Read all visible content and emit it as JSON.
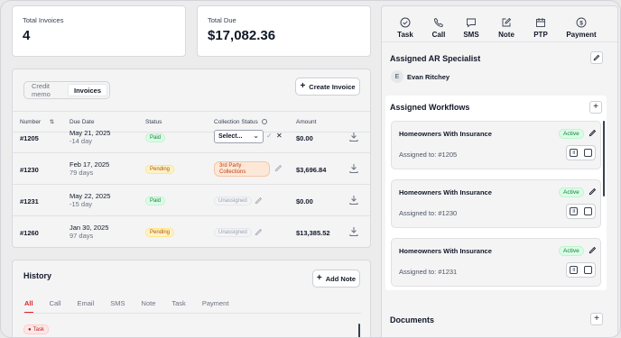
{
  "stats": {
    "total_invoices_label": "Total Invoices",
    "total_invoices_value": "4",
    "total_due_label": "Total Due",
    "total_due_value": "$17,082.36"
  },
  "invoices": {
    "segments": [
      "Credit memo",
      "Invoices"
    ],
    "create_label": "Create Invoice",
    "columns": [
      "Number",
      "Due Date",
      "Status",
      "Collection Status",
      "Amount"
    ],
    "rows": [
      {
        "number": "#1205",
        "due": "May 21, 2025",
        "due_sub": "-14 day",
        "status": "Paid",
        "collection": "select",
        "amount": "$0.00"
      },
      {
        "number": "#1230",
        "due": "Feb 17, 2025",
        "due_sub": "79 days",
        "status": "Pending",
        "collection": "3rd Party Collections",
        "amount": "$3,696.84"
      },
      {
        "number": "#1231",
        "due": "May 22, 2025",
        "due_sub": "-15 day",
        "status": "Paid",
        "collection": "Unassigned",
        "amount": "$0.00"
      },
      {
        "number": "#1260",
        "due": "Jan 30, 2025",
        "due_sub": "97 days",
        "status": "Pending",
        "collection": "Unassigned",
        "amount": "$13,385.52"
      }
    ],
    "select_placeholder": "Select..."
  },
  "history": {
    "title": "History",
    "add_note_label": "Add Note",
    "tabs": [
      "All",
      "Call",
      "Email",
      "SMS",
      "Note",
      "Task",
      "Payment"
    ],
    "first_item_tag": "Task"
  },
  "actions": [
    {
      "label": "Task",
      "icon": "check-circle-icon"
    },
    {
      "label": "Call",
      "icon": "phone-icon"
    },
    {
      "label": "SMS",
      "icon": "message-icon"
    },
    {
      "label": "Note",
      "icon": "edit-note-icon"
    },
    {
      "label": "PTP",
      "icon": "calendar-icon"
    },
    {
      "label": "Payment",
      "icon": "dollar-circle-icon"
    }
  ],
  "ar_specialist": {
    "title": "Assigned AR Specialist",
    "avatar_initial": "E",
    "name": "Evan Ritchey"
  },
  "workflows": {
    "title": "Assigned Workflows",
    "items": [
      {
        "name": "Homeowners With Insurance",
        "status": "Active",
        "assigned": "Assigned to: #1205"
      },
      {
        "name": "Homeowners With Insurance",
        "status": "Active",
        "assigned": "Assigned to: #1230"
      },
      {
        "name": "Homeowners With Insurance",
        "status": "Active",
        "assigned": "Assigned to: #1231"
      }
    ]
  },
  "documents": {
    "title": "Documents"
  },
  "colors": {
    "accent_red": "#dc2626",
    "paid_green": "#15803d",
    "pending_amber": "#b45309"
  }
}
